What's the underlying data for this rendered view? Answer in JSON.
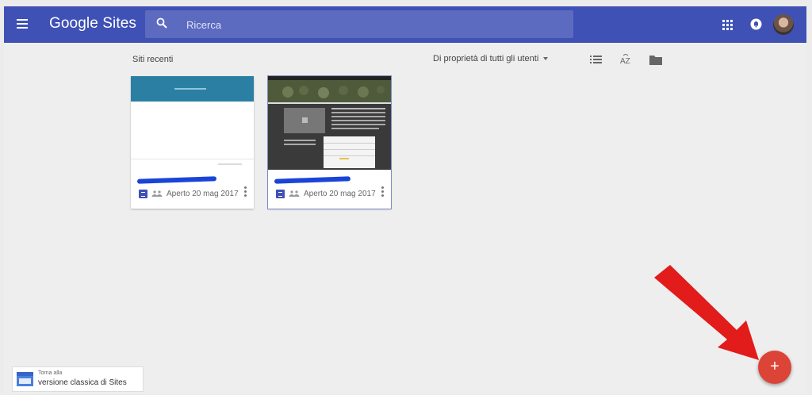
{
  "header": {
    "app_title": "Google Sites",
    "search_placeholder": "Ricerca",
    "accent_color": "#3f51b5"
  },
  "toolbar": {
    "section_title": "Siti recenti",
    "owner_filter_label": "Di proprietà di tutti gli utenti",
    "icons": [
      "list-view-icon",
      "sort-az-icon",
      "folder-icon"
    ]
  },
  "sites": [
    {
      "opened_label": "Aperto",
      "date": "20 mag 2017",
      "selected": false
    },
    {
      "opened_label": "Aperto",
      "date": "20 mag 2017",
      "selected": true
    }
  ],
  "classic_link": {
    "small_text": "Torna alla",
    "main_text": "versione classica di Sites"
  },
  "fab": {
    "label": "+",
    "color": "#db4437"
  }
}
